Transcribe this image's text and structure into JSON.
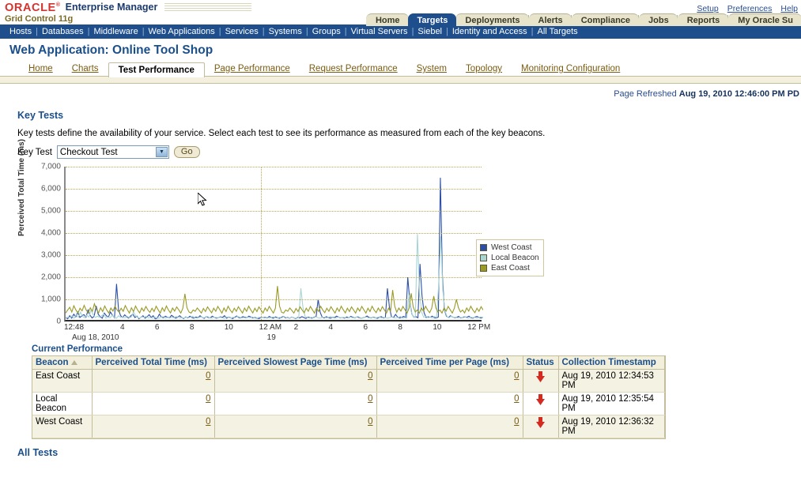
{
  "brand": {
    "oracle": "ORACLE",
    "reg": "®",
    "product": "Enterprise Manager",
    "edition": "Grid Control 11g"
  },
  "top_links": [
    {
      "label": "Setup"
    },
    {
      "label": "Preferences"
    },
    {
      "label": "Help"
    }
  ],
  "main_tabs": [
    {
      "label": "Home",
      "active": false
    },
    {
      "label": "Targets",
      "active": true
    },
    {
      "label": "Deployments",
      "active": false
    },
    {
      "label": "Alerts",
      "active": false
    },
    {
      "label": "Compliance",
      "active": false
    },
    {
      "label": "Jobs",
      "active": false
    },
    {
      "label": "Reports",
      "active": false
    },
    {
      "label": "My Oracle Su",
      "active": false
    }
  ],
  "subnav": [
    "Hosts",
    "Databases",
    "Middleware",
    "Web Applications",
    "Services",
    "Systems",
    "Groups",
    "Virtual Servers",
    "Siebel",
    "Identity and Access",
    "All Targets"
  ],
  "page": {
    "title": "Web Application: Online Tool Shop",
    "refreshed_label": "Page Refreshed",
    "refreshed_value": "Aug 19, 2010 12:46:00 PM PD"
  },
  "content_tabs": [
    {
      "label": "Home",
      "active": false
    },
    {
      "label": "Charts",
      "active": false
    },
    {
      "label": "Test Performance",
      "active": true
    },
    {
      "label": "Page Performance",
      "active": false
    },
    {
      "label": "Request Performance",
      "active": false
    },
    {
      "label": "System",
      "active": false
    },
    {
      "label": "Topology",
      "active": false
    },
    {
      "label": "Monitoring Configuration",
      "active": false
    }
  ],
  "key_tests": {
    "heading": "Key Tests",
    "description": "Key tests define the availability of your service. Select each test to see its performance as measured from each of the key beacons.",
    "select_label": "Key Test",
    "selected_test": "Checkout Test",
    "go_label": "Go"
  },
  "chart_data": {
    "type": "line",
    "title": "",
    "xlabel": "",
    "ylabel": "Perceived Total Time (ms)",
    "ylim": [
      0,
      7000
    ],
    "yticks": [
      0,
      1000,
      2000,
      3000,
      4000,
      5000,
      6000,
      7000
    ],
    "ytick_labels": [
      "0",
      "1,000",
      "2,000",
      "3,000",
      "4,000",
      "5,000",
      "6,000",
      "7,000"
    ],
    "grid": true,
    "legend_position": "right",
    "xticks": [
      {
        "label": "12:48",
        "sub": "Aug 18, 2010",
        "pos": 0.0
      },
      {
        "label": "4",
        "sub": "",
        "pos": 0.1344
      },
      {
        "label": "6",
        "sub": "",
        "pos": 0.2176
      },
      {
        "label": "8",
        "sub": "",
        "pos": 0.3008
      },
      {
        "label": "10",
        "sub": "",
        "pos": 0.384
      },
      {
        "label": "12 AM",
        "sub": "19",
        "pos": 0.4672
      },
      {
        "label": "2",
        "sub": "",
        "pos": 0.5504
      },
      {
        "label": "4",
        "sub": "",
        "pos": 0.6336
      },
      {
        "label": "6",
        "sub": "",
        "pos": 0.7168
      },
      {
        "label": "8",
        "sub": "",
        "pos": 0.8
      },
      {
        "label": "10",
        "sub": "",
        "pos": 0.8832
      },
      {
        "label": "12 PM",
        "sub": "",
        "pos": 0.9664
      }
    ],
    "day_divider_pos": 0.4672,
    "series": [
      {
        "name": "West Coast",
        "color": "#2b4fa8",
        "values": [
          180,
          120,
          260,
          150,
          330,
          210,
          420,
          180,
          260,
          310,
          190,
          520,
          280,
          160,
          240,
          700,
          330,
          210,
          150,
          380,
          260,
          190,
          430,
          280,
          170,
          1700,
          520,
          260,
          180,
          300,
          210,
          150,
          260,
          330,
          180,
          240,
          120,
          190,
          260,
          150,
          210,
          310,
          180,
          260,
          120,
          150,
          330,
          200,
          170,
          240,
          190,
          160,
          280,
          210,
          150,
          190,
          260,
          180,
          130,
          210,
          160,
          240,
          180,
          150,
          200,
          170,
          260,
          190,
          140,
          220,
          180,
          160,
          240,
          190,
          150,
          170,
          210,
          180,
          260,
          150,
          200,
          170,
          130,
          190,
          250,
          180,
          160,
          220,
          190,
          170,
          240,
          200,
          160,
          180,
          150,
          130,
          200,
          170,
          190,
          160,
          230,
          180,
          150,
          210,
          170,
          140,
          190,
          230,
          160,
          180,
          150,
          200,
          170,
          130,
          190,
          160,
          220,
          180,
          140,
          200,
          170,
          150,
          190,
          230,
          1000,
          410,
          190,
          160,
          220,
          180,
          150,
          190,
          170,
          240,
          200,
          160,
          180,
          150,
          200,
          170,
          230,
          190,
          160,
          210,
          180,
          150,
          170,
          190,
          250,
          180,
          160,
          200,
          170,
          140,
          190,
          220,
          160,
          180,
          1500,
          640,
          210,
          180,
          320,
          200,
          160,
          190,
          230,
          170,
          2000,
          900,
          340,
          190,
          220,
          170,
          2600,
          1150,
          400,
          180,
          210,
          190,
          240,
          170,
          160,
          200,
          6500,
          2100,
          520,
          230,
          180,
          260,
          200,
          170,
          190,
          230,
          160,
          180,
          210,
          190,
          240,
          170,
          150,
          200,
          230,
          180,
          160,
          190
        ]
      },
      {
        "name": "Local Beacon",
        "color": "#a8d4d4",
        "values": [
          140,
          200,
          180,
          260,
          150,
          310,
          190,
          420,
          230,
          170,
          280,
          200,
          520,
          310,
          180,
          240,
          190,
          260,
          330,
          150,
          200,
          170,
          280,
          190,
          150,
          260,
          180,
          210,
          160,
          240,
          170,
          200,
          430,
          260,
          180,
          150,
          210,
          190,
          240,
          160,
          180,
          150,
          200,
          170,
          140,
          190,
          220,
          160,
          180,
          150,
          190,
          170,
          230,
          200,
          160,
          180,
          150,
          200,
          170,
          190,
          240,
          160,
          150,
          180,
          210,
          170,
          190,
          230,
          160,
          150,
          200,
          180,
          170,
          190,
          160,
          140,
          210,
          180,
          150,
          190,
          170,
          230,
          200,
          160,
          180,
          150,
          190,
          170,
          210,
          160,
          140,
          180,
          200,
          170,
          150,
          190,
          160,
          180,
          210,
          170,
          150,
          190,
          160,
          230,
          180,
          150,
          170,
          200,
          160,
          140,
          190,
          1500,
          620,
          230,
          180,
          150,
          190,
          160,
          210,
          170,
          150,
          180,
          200,
          160,
          190,
          230,
          170,
          150,
          180,
          200,
          160,
          190,
          170,
          150,
          210,
          180,
          160,
          190,
          230,
          170,
          150,
          180,
          200,
          160,
          170,
          190,
          150,
          180,
          210,
          160,
          190,
          170,
          150,
          180,
          200,
          160,
          170,
          190,
          230,
          150,
          180,
          160,
          1200,
          470,
          210,
          180,
          3950,
          1300,
          420,
          190,
          240,
          170,
          200,
          160,
          230,
          180,
          1600,
          3850,
          1400,
          480,
          210,
          170,
          250,
          180,
          200,
          160,
          190,
          170,
          230,
          180,
          150,
          200,
          170,
          190,
          160,
          180,
          210,
          170
        ]
      },
      {
        "name": "East Coast",
        "color": "#9a9a27",
        "values": [
          380,
          520,
          640,
          430,
          710,
          520,
          380,
          600,
          480,
          730,
          520,
          390,
          620,
          460,
          800,
          540,
          390,
          620,
          450,
          700,
          520,
          380,
          610,
          470,
          690,
          520,
          420,
          600,
          460,
          720,
          540,
          380,
          620,
          450,
          700,
          520,
          390,
          610,
          470,
          680,
          520,
          410,
          600,
          450,
          690,
          530,
          380,
          620,
          460,
          700,
          520,
          390,
          610,
          470,
          660,
          530,
          380,
          600,
          1250,
          620,
          430,
          380,
          520,
          460,
          610,
          500,
          380,
          590,
          450,
          660,
          520,
          390,
          600,
          460,
          680,
          530,
          380,
          610,
          450,
          690,
          520,
          400,
          600,
          460,
          670,
          520,
          380,
          610,
          460,
          690,
          530,
          390,
          600,
          450,
          660,
          520,
          380,
          610,
          470,
          680,
          530,
          380,
          600,
          1600,
          700,
          420,
          380,
          520,
          460,
          610,
          500,
          380,
          590,
          450,
          660,
          520,
          390,
          600,
          460,
          680,
          530,
          380,
          610,
          450,
          690,
          520,
          400,
          600,
          460,
          670,
          520,
          380,
          610,
          460,
          690,
          530,
          390,
          600,
          450,
          660,
          520,
          380,
          610,
          470,
          680,
          530,
          380,
          600,
          450,
          690,
          520,
          400,
          610,
          460,
          670,
          520,
          380,
          600,
          460,
          1420,
          700,
          420,
          610,
          470,
          680,
          530,
          380,
          600,
          1280,
          660,
          430,
          520,
          380,
          610,
          470,
          690,
          520,
          400,
          600,
          1150,
          620,
          430,
          520,
          380,
          610,
          470,
          680,
          530,
          380,
          600,
          1000,
          620,
          430,
          520,
          390,
          610,
          470,
          690,
          520,
          400,
          600,
          460,
          670,
          520
        ]
      }
    ]
  },
  "current_performance": {
    "title": "Current Performance",
    "columns": [
      "Beacon",
      "Perceived Total Time (ms)",
      "Perceived Slowest Page Time (ms)",
      "Perceived Time per Page (ms)",
      "Status",
      "Collection Timestamp"
    ],
    "rows": [
      {
        "beacon": "East Coast",
        "total_time": "0",
        "slowest_page_time": "0",
        "time_per_page": "0",
        "status": "down",
        "timestamp": "Aug 19, 2010 12:34:53 PM"
      },
      {
        "beacon": "Local Beacon",
        "total_time": "0",
        "slowest_page_time": "0",
        "time_per_page": "0",
        "status": "down",
        "timestamp": "Aug 19, 2010 12:35:54 PM"
      },
      {
        "beacon": "West Coast",
        "total_time": "0",
        "slowest_page_time": "0",
        "time_per_page": "0",
        "status": "down",
        "timestamp": "Aug 19, 2010 12:36:32 PM"
      }
    ]
  },
  "all_tests": {
    "title": "All Tests"
  },
  "colors": {
    "brand_red": "#d4332e",
    "nav_blue": "#1f4e8c",
    "heading_blue": "#1b4f8a",
    "status_red": "#d42a20"
  }
}
